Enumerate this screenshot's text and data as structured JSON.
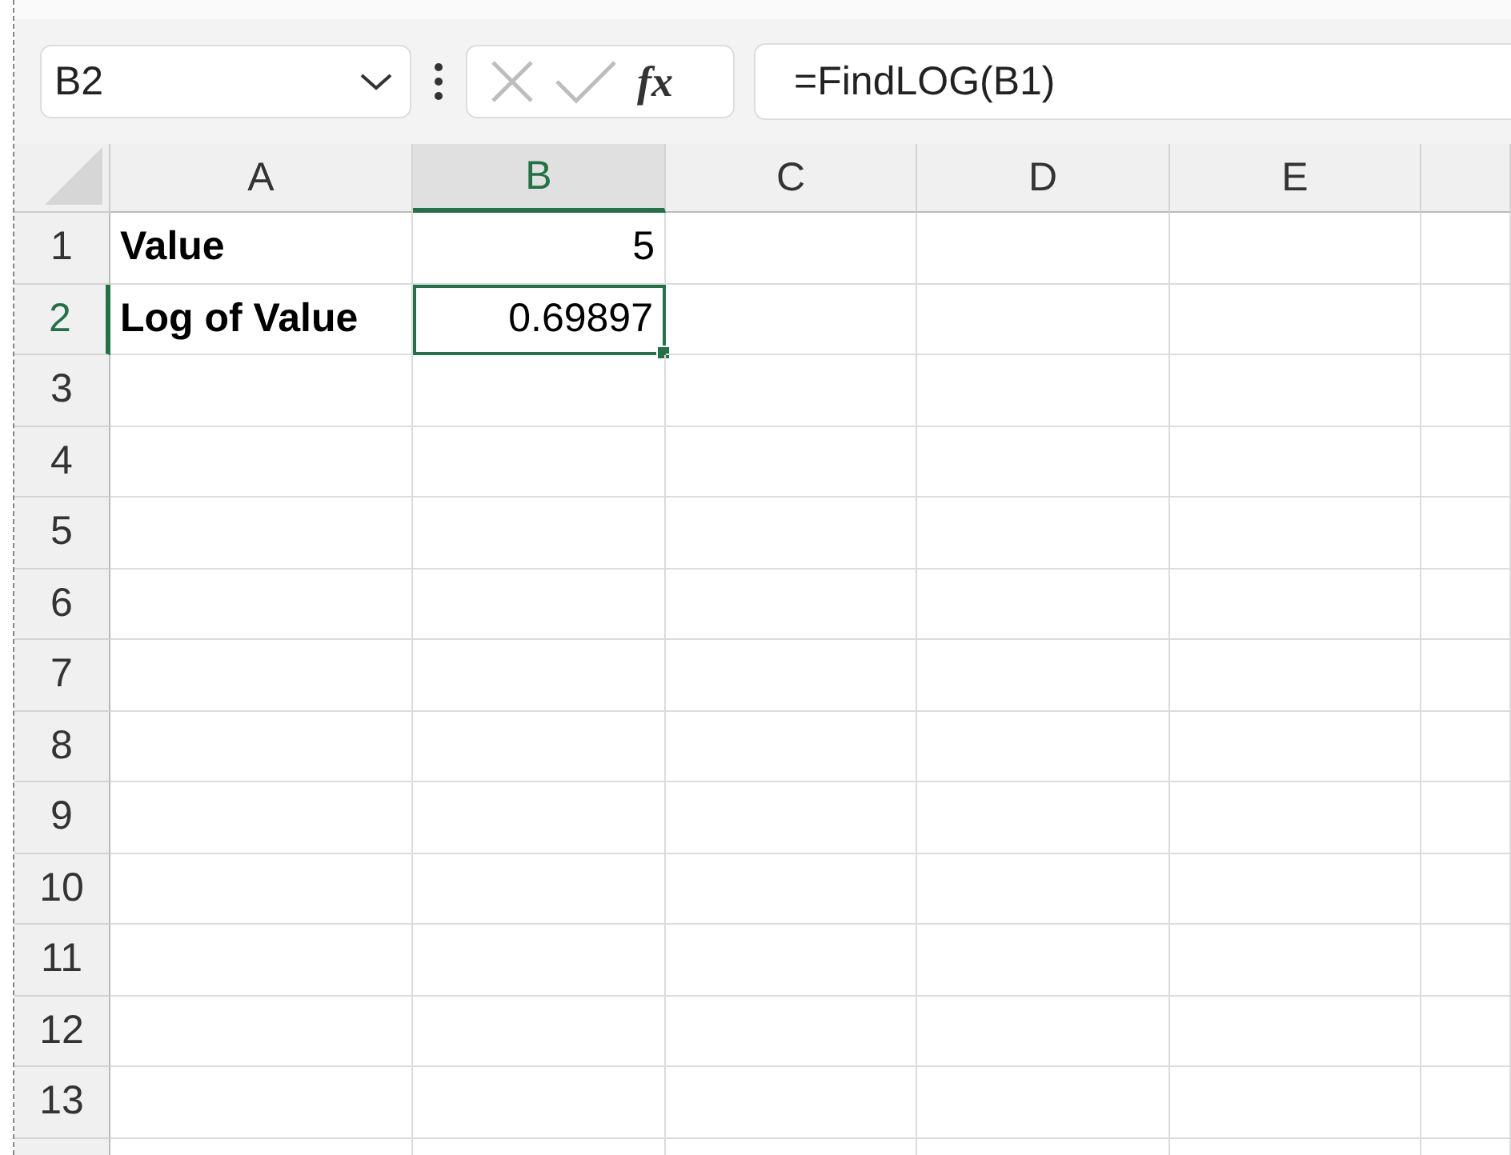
{
  "name_box": {
    "value": "B2"
  },
  "formula_bar": {
    "fx_label": "fx",
    "value": "=FindLOG(B1)"
  },
  "columns": [
    {
      "label": "A",
      "selected": false
    },
    {
      "label": "B",
      "selected": true
    },
    {
      "label": "C",
      "selected": false
    },
    {
      "label": "D",
      "selected": false
    },
    {
      "label": "E",
      "selected": false
    }
  ],
  "rows": [
    {
      "label": "1",
      "selected": false,
      "cells": [
        {
          "text": "Value",
          "kind": "label",
          "active": false
        },
        {
          "text": "5",
          "kind": "number",
          "active": false
        }
      ]
    },
    {
      "label": "2",
      "selected": true,
      "cells": [
        {
          "text": "Log of Value",
          "kind": "label",
          "active": false
        },
        {
          "text": "0.69897",
          "kind": "number",
          "active": true
        }
      ]
    },
    {
      "label": "3",
      "selected": false,
      "cells": []
    },
    {
      "label": "4",
      "selected": false,
      "cells": []
    },
    {
      "label": "5",
      "selected": false,
      "cells": []
    },
    {
      "label": "6",
      "selected": false,
      "cells": []
    },
    {
      "label": "7",
      "selected": false,
      "cells": []
    },
    {
      "label": "8",
      "selected": false,
      "cells": []
    },
    {
      "label": "9",
      "selected": false,
      "cells": []
    },
    {
      "label": "10",
      "selected": false,
      "cells": []
    },
    {
      "label": "11",
      "selected": false,
      "cells": []
    },
    {
      "label": "12",
      "selected": false,
      "cells": []
    },
    {
      "label": "13",
      "selected": false,
      "cells": []
    }
  ]
}
